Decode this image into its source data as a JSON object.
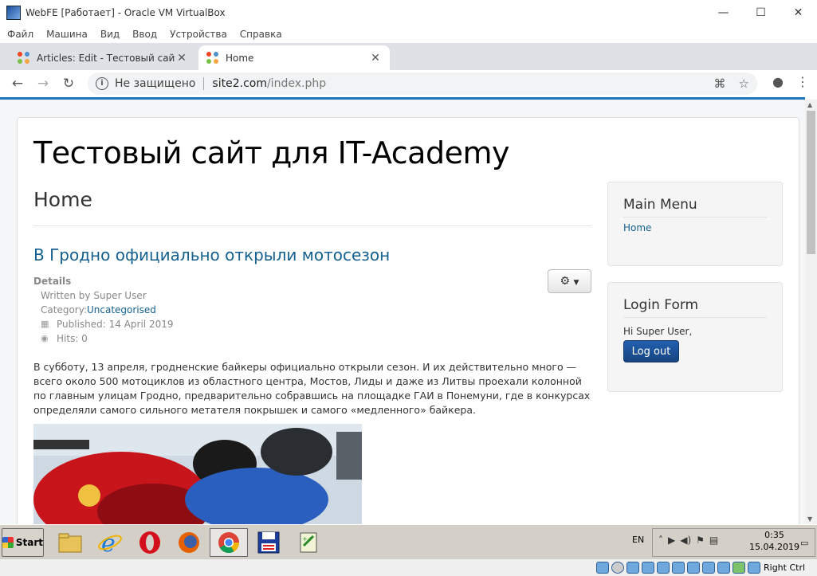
{
  "vbox": {
    "window_title": "WebFE [Работает] - Oracle VM VirtualBox",
    "menu": [
      "Файл",
      "Машина",
      "Вид",
      "Ввод",
      "Устройства",
      "Справка"
    ],
    "min": "—",
    "max": "☐",
    "close": "✕",
    "status_right": "Right Ctrl"
  },
  "chrome": {
    "tabs": [
      {
        "label": "Articles: Edit - Тестовый сайт для IT-Academy",
        "active": false
      },
      {
        "label": "Home",
        "active": true
      }
    ],
    "new_tab": "+",
    "insecure_label": "Не защищено",
    "url_host": "site2.com",
    "url_path": "/index.php"
  },
  "site": {
    "title": "Тестовый сайт для IT-Academy",
    "page_heading": "Home",
    "article": {
      "title": "В Гродно официально открыли мотосезон",
      "details_label": "Details",
      "written_by": "Written by Super User",
      "category_prefix": "Category: ",
      "category": "Uncategorised",
      "published": "Published: 14 April 2019",
      "hits": "Hits: 0",
      "body": "В субботу, 13 апреля, гродненские байкеры официально открыли сезон. И их действительно много — всего около 500 мотоциклов из областного центра, Мостов, Лиды и даже из Литвы проехали колонной по главным улицам Гродно, предварительно собравшись на площадке ГАИ в Понемуни, где в конкурсах определяли самого сильного метателя покрышек и самого «медленного» байкера."
    },
    "main_menu": {
      "title": "Main Menu",
      "items": [
        "Home"
      ]
    },
    "login_form": {
      "title": "Login Form",
      "greeting": "Hi Super User,",
      "logout": "Log out"
    }
  },
  "taskbar": {
    "start": "Start",
    "lang": "EN",
    "time": "0:35",
    "date": "15.04.2019"
  },
  "colors": {
    "link": "#15608f",
    "accent_bar": "#1c75bc",
    "logout_button": "#1f5ba6"
  }
}
